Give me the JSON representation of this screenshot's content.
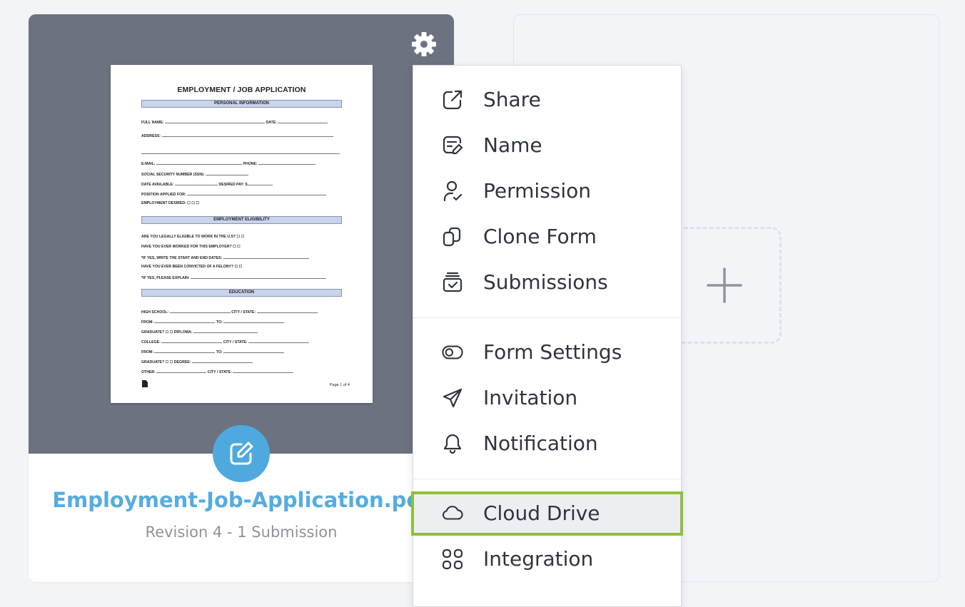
{
  "form": {
    "filename": "Employment-Job-Application.pdf",
    "subtitle": "Revision 4 - 1 Submission",
    "settings_icon": "gear-icon",
    "edit_icon": "edit-icon",
    "preview": {
      "title": "EMPLOYMENT / JOB APPLICATION",
      "sections": [
        "PERSONAL INFORMATION",
        "EMPLOYMENT ELIGIBILITY",
        "EDUCATION"
      ],
      "personal_lines": [
        "FULL NAME:",
        "ADDRESS:",
        "E-MAIL:",
        "SOCIAL SECURITY NUMBER (SSN):",
        "DATE AVAILABLE:",
        "POSITION APPLIED FOR:",
        "EMPLOYMENT DESIRED:"
      ],
      "eligibility_lines": [
        "ARE YOU LEGALLY ELIGIBLE TO WORK IN THE U.S?",
        "HAVE YOU EVER WORKED FOR THIS EMPLOYER?",
        "*IF YES, WRITE THE START AND END DATES:",
        "HAVE YOU EVER BEEN CONVICTED OF A FELONY?",
        "*IF YES, PLEASE EXPLAIN:"
      ],
      "education_lines": [
        "HIGH SCHOOL:",
        "FROM:",
        "GRADUATE?",
        "COLLEGE:",
        "FROM:",
        "GRADUATE?",
        "OTHER:"
      ],
      "page_label": "Page 1 of 4"
    }
  },
  "add_card": {
    "icon": "plus-icon"
  },
  "menu": {
    "items": [
      {
        "label": "Share",
        "icon": "share-icon"
      },
      {
        "label": "Name",
        "icon": "rename-icon"
      },
      {
        "label": "Permission",
        "icon": "user-check-icon"
      },
      {
        "label": "Clone Form",
        "icon": "clone-icon"
      },
      {
        "label": "Submissions",
        "icon": "inbox-icon"
      },
      {
        "label": "Form Settings",
        "icon": "toggle-icon"
      },
      {
        "label": "Invitation",
        "icon": "send-icon"
      },
      {
        "label": "Notification",
        "icon": "bell-icon"
      },
      {
        "label": "Cloud Drive",
        "icon": "cloud-icon"
      },
      {
        "label": "Integration",
        "icon": "grid-icon"
      }
    ],
    "highlight_color": "#8fbe3e"
  },
  "colors": {
    "accent": "#55acdf",
    "edit_button": "#4eaade",
    "card_header": "#6c7280",
    "page_bg": "#f3f4f8"
  }
}
